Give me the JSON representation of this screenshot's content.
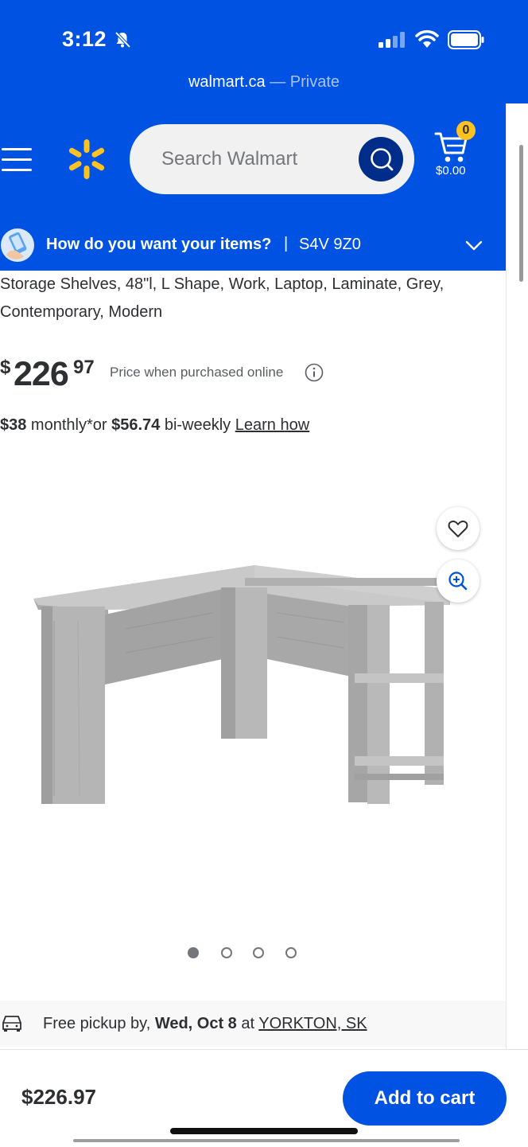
{
  "status_bar": {
    "time": "3:12",
    "bell_icon": "bell-slash-icon",
    "signal_icon": "cellular-signal-icon",
    "wifi_icon": "wifi-icon",
    "battery_icon": "battery-icon"
  },
  "browser": {
    "domain": "walmart.ca",
    "mode": "— Private"
  },
  "header": {
    "menu_icon": "hamburger-menu-icon",
    "logo": "walmart-spark-logo",
    "search_placeholder": "Search Walmart",
    "search_icon": "search-icon",
    "cart_count": "0",
    "cart_total": "$0.00",
    "brand_color": "#0053e2",
    "accent_color": "#ffc220"
  },
  "fulfillment": {
    "question": "How do you want your items?",
    "divider": "|",
    "postal_code": "S4V 9Z0",
    "chevron_icon": "chevron-down-icon"
  },
  "product": {
    "title": "Storage Shelves, 48\"l, L Shape, Work, Laptop, Laminate, Grey, Contemporary, Modern",
    "price_symbol": "$",
    "price_dollars": "226",
    "price_cents": "97",
    "price_note": "Price when purchased online",
    "monthly_amount": "$38",
    "monthly_text": " monthly*or ",
    "biweekly_amount": "$56.74",
    "biweekly_text": " bi-weekly ",
    "learn_link": "Learn how"
  },
  "carousel": {
    "image": "grey-l-shaped-desk",
    "total_images": 4,
    "active_index": 1
  },
  "pickup": {
    "prefix": "Free pickup by, ",
    "date": "Wed, Oct 8",
    "mid": " at ",
    "store": "YORKTON, SK"
  },
  "footer": {
    "price": "$226.97",
    "add_to_cart": "Add to cart"
  }
}
